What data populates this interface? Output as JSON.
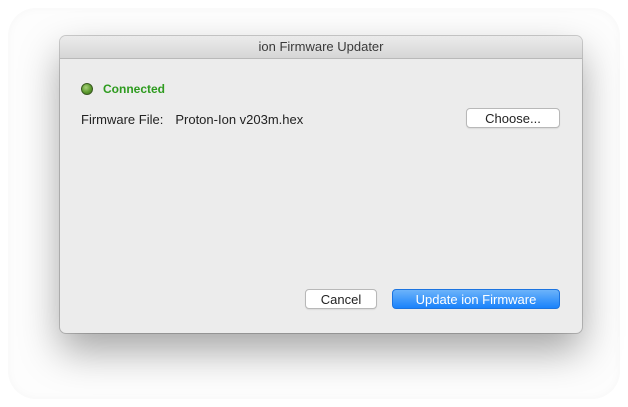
{
  "window": {
    "title": "ion Firmware Updater"
  },
  "status": {
    "text": "Connected",
    "color": "#2e9b1f",
    "indicator": "led-icon"
  },
  "firmware": {
    "label": "Firmware File:",
    "filename": "Proton-Ion v203m.hex"
  },
  "buttons": {
    "choose_label": "Choose...",
    "cancel_label": "Cancel",
    "update_label": "Update ion Firmware"
  },
  "colors": {
    "accent": "#1a82fb",
    "window_bg": "#ececec"
  }
}
